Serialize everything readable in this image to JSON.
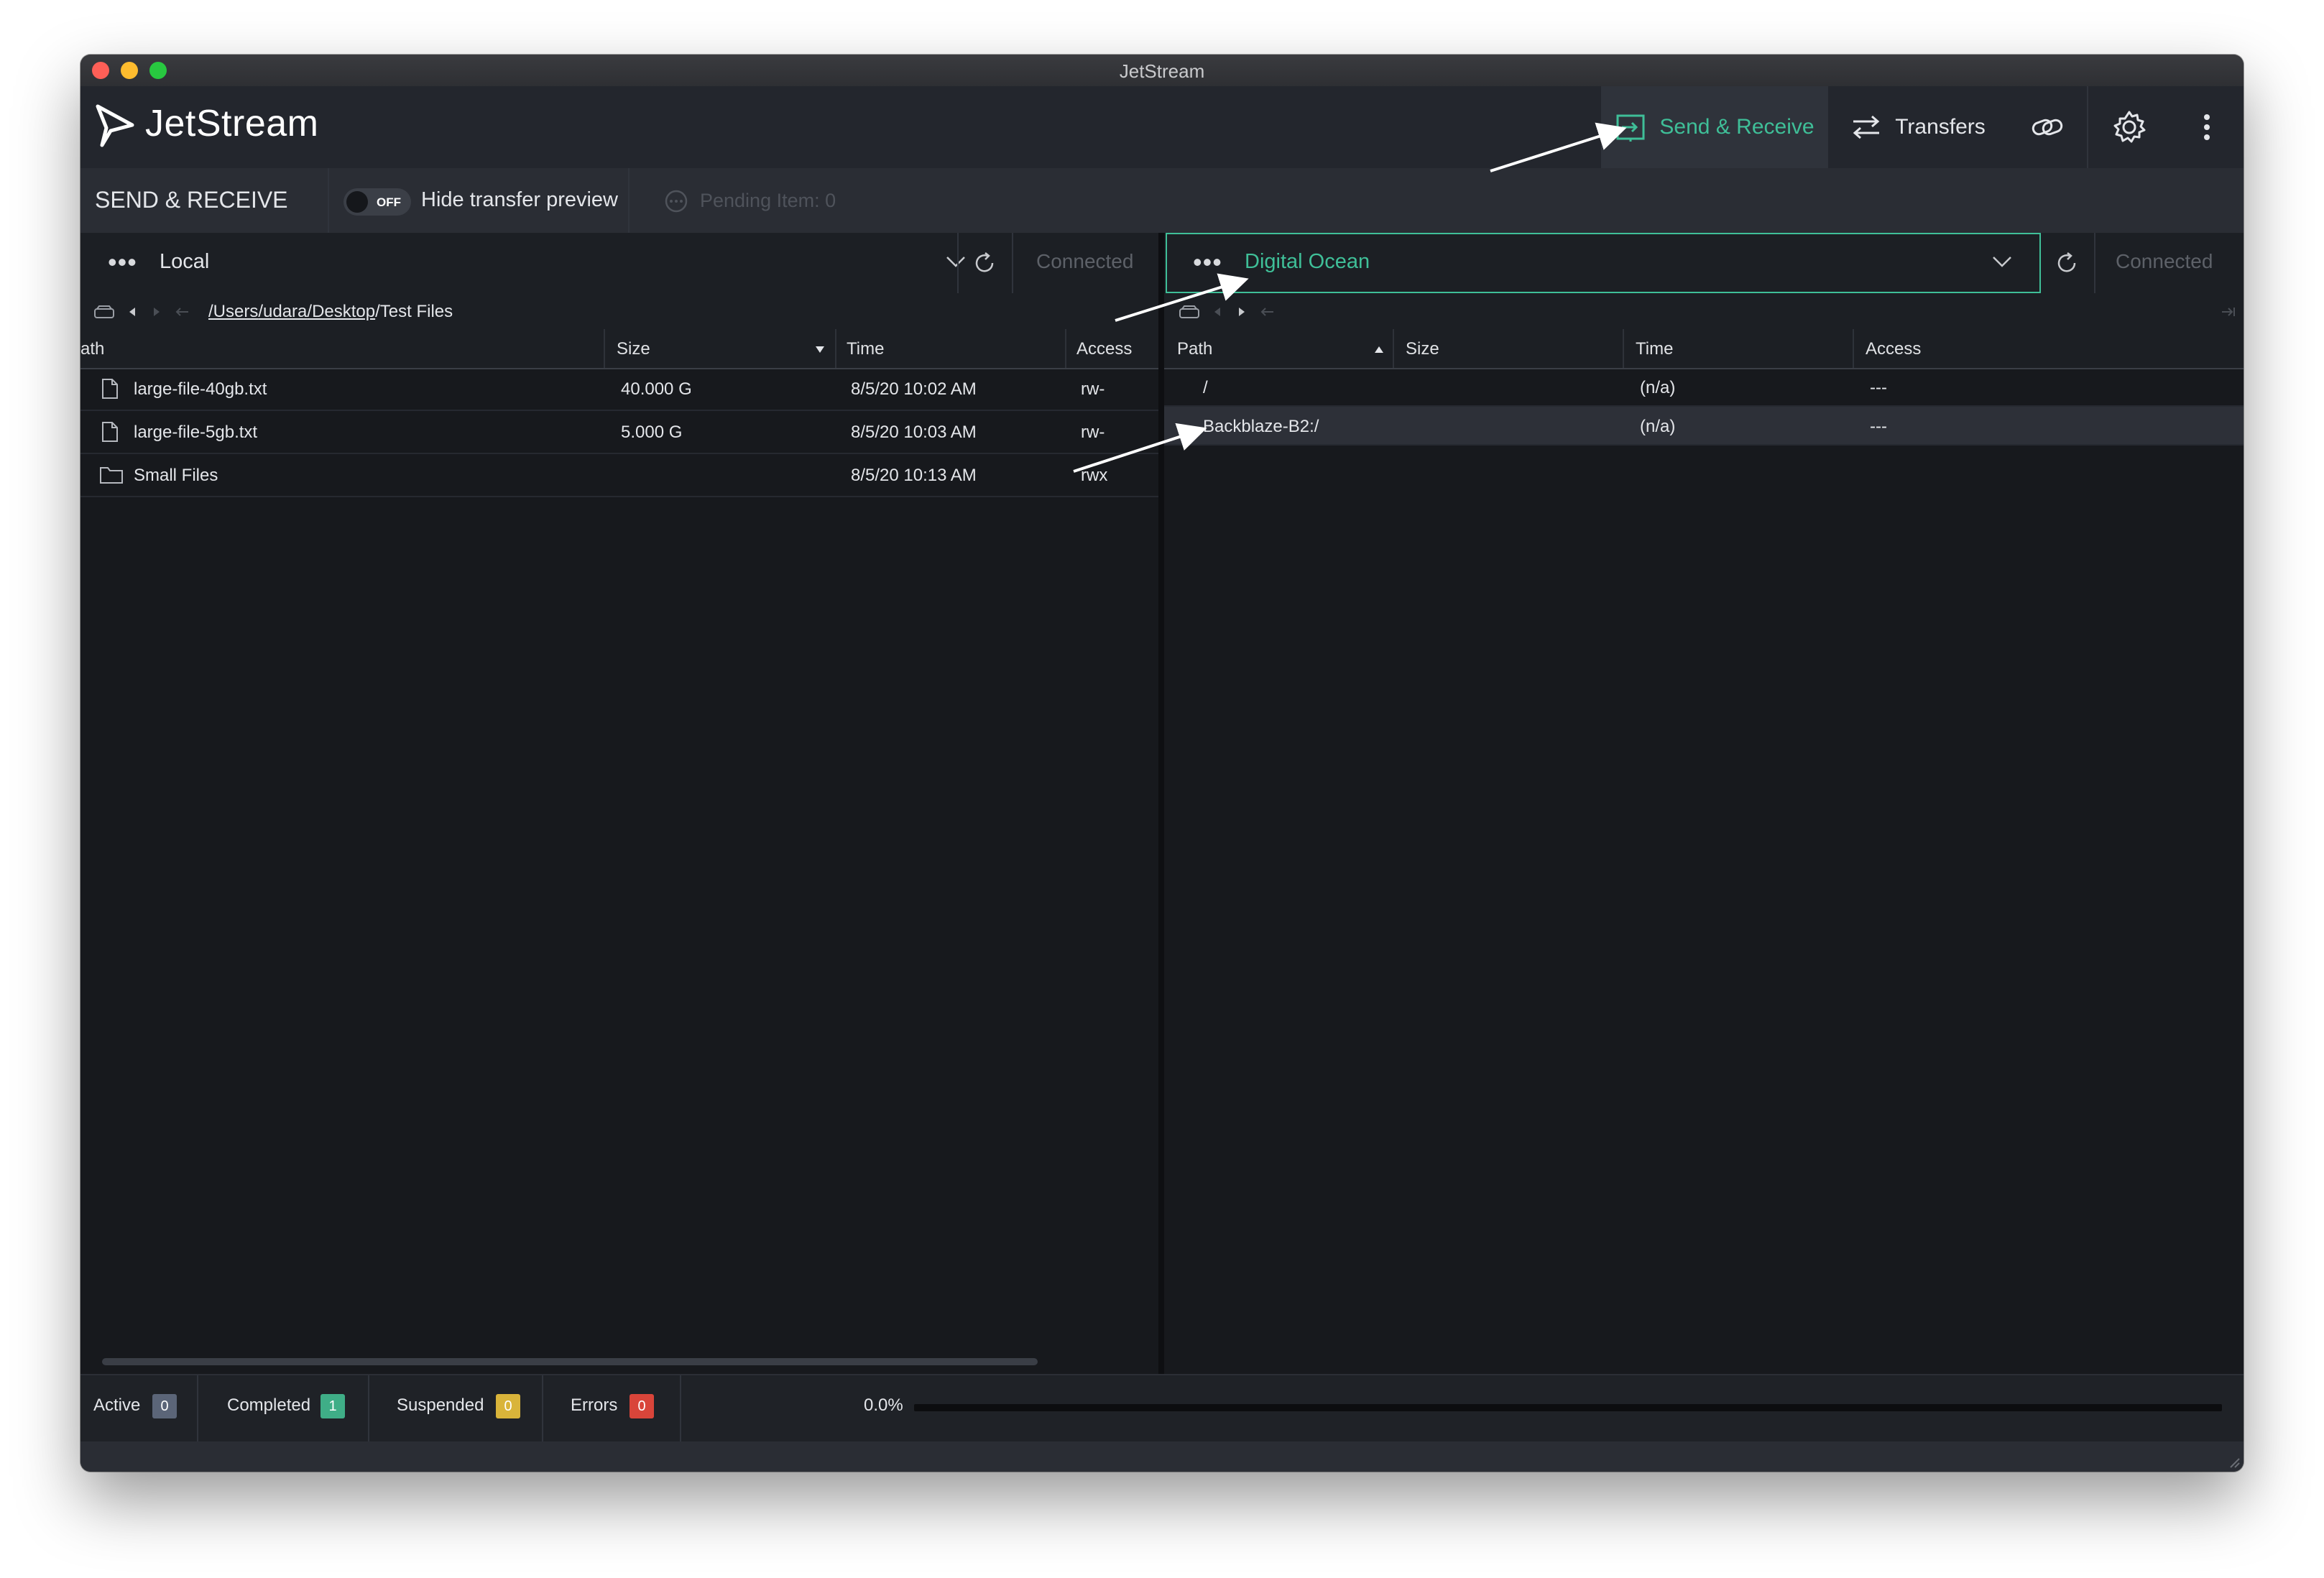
{
  "window": {
    "title": "JetStream"
  },
  "app": {
    "name": "JetStream"
  },
  "nav": {
    "send_receive": "Send & Receive",
    "transfers": "Transfers"
  },
  "toolbar": {
    "section_title": "SEND & RECEIVE",
    "toggle_state": "OFF",
    "toggle_label": "Hide transfer preview",
    "pending": "Pending Item: 0"
  },
  "left_pane": {
    "location": "Local",
    "status": "Connected",
    "path_segments": [
      "/Users",
      "/udara",
      "/Desktop",
      "/Test Files"
    ],
    "columns": [
      "ath",
      "Size",
      "Time",
      "Access"
    ],
    "rows": [
      {
        "name": "large-file-40gb.txt",
        "size": "40.000 G",
        "time": "8/5/20 10:02 AM",
        "access": "rw-",
        "icon": "file-icon"
      },
      {
        "name": "large-file-5gb.txt",
        "size": "5.000 G",
        "time": "8/5/20 10:03 AM",
        "access": "rw-",
        "icon": "file-icon"
      },
      {
        "name": "Small Files",
        "size": "",
        "time": "8/5/20 10:13 AM",
        "access": "rwx",
        "icon": "folder-icon"
      }
    ]
  },
  "right_pane": {
    "location": "Digital Ocean",
    "status": "Connected",
    "columns": [
      "Path",
      "Size",
      "Time",
      "Access"
    ],
    "rows": [
      {
        "name": "/",
        "size": "",
        "time": "(n/a)",
        "access": "---"
      },
      {
        "name": "Backblaze-B2:/",
        "size": "",
        "time": "(n/a)",
        "access": "---"
      }
    ]
  },
  "status_bar": {
    "active": {
      "label": "Active",
      "count": "0"
    },
    "completed": {
      "label": "Completed",
      "count": "1"
    },
    "suspended": {
      "label": "Suspended",
      "count": "0"
    },
    "errors": {
      "label": "Errors",
      "count": "0"
    },
    "progress_text": "0.0%",
    "progress": 0
  },
  "colors": {
    "accent": "#3fbf98",
    "background": "#17191d",
    "header": "#23262d",
    "badge_neutral": "#5b6578",
    "badge_completed": "#3fae87",
    "badge_suspended": "#d9b43a",
    "badge_errors": "#d9453a"
  }
}
